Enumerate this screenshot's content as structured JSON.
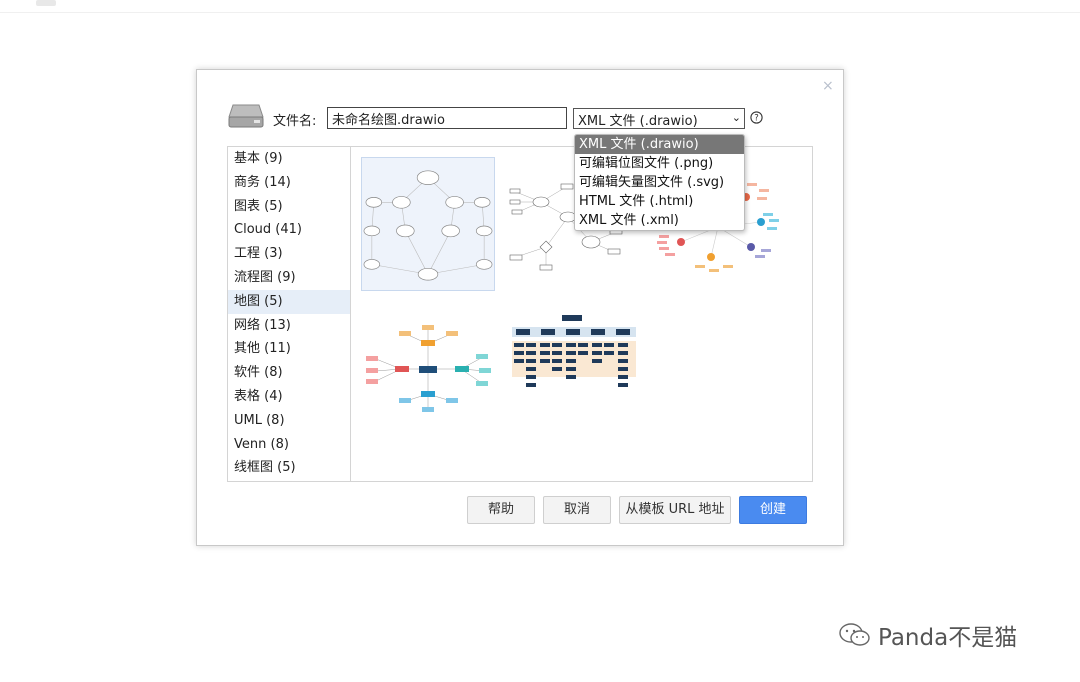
{
  "filename_label": "文件名:",
  "filename_value": "未命名绘图.drawio",
  "format_selected": "XML 文件 (.drawio)",
  "format_options": [
    "XML 文件 (.drawio)",
    "可编辑位图文件 (.png)",
    "可编辑矢量图文件 (.svg)",
    "HTML 文件 (.html)",
    "XML 文件 (.xml)"
  ],
  "categories": [
    "基本 (9)",
    "商务 (14)",
    "图表 (5)",
    "Cloud (41)",
    "工程 (3)",
    "流程图 (9)",
    "地图 (5)",
    "网络 (13)",
    "其他 (11)",
    "软件 (8)",
    "表格 (4)",
    "UML (8)",
    "Venn (8)",
    "线框图 (5)"
  ],
  "active_category": "地图 (5)",
  "buttons": {
    "help": "帮助",
    "cancel": "取消",
    "from_url": "从模板 URL 地址",
    "create": "创建"
  },
  "close_glyph": "×",
  "watermark": "Panda不是猫",
  "icons": {
    "drive": "hard-drive-icon",
    "help": "question-circle-icon",
    "close": "close-icon",
    "dropdown": "chevron-down-icon",
    "wechat": "wechat-icon"
  },
  "colors": {
    "primary": "#4a8bf0",
    "selected_option": "#777777",
    "active_category": "#e6eef8"
  }
}
